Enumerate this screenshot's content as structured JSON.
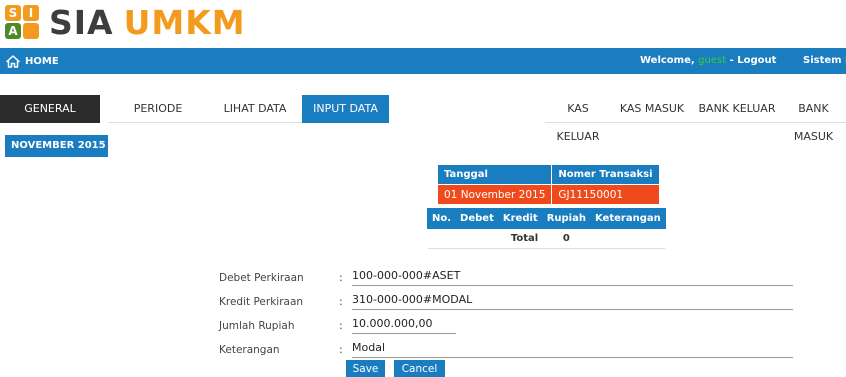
{
  "logo": {
    "sia": "SIA",
    "umkm": "UMKM",
    "tiles": [
      "S",
      "I",
      "A",
      ""
    ]
  },
  "topbar": {
    "home_label": "HOME",
    "welcome_prefix": "Welcome, ",
    "user": "guest",
    "logout": " - Logout",
    "sistem": "Sistem In"
  },
  "tabs": {
    "left": [
      "GENERAL JOURNAL",
      "PERIODE",
      "LIHAT DATA",
      "INPUT DATA"
    ],
    "right": [
      "KAS KELUAR",
      "KAS MASUK",
      "BANK KELUAR",
      "BANK MASUK"
    ]
  },
  "period_badge": "NOVEMBER 2015",
  "header_table": {
    "columns": [
      "Tanggal",
      "Nomer Transaksi"
    ],
    "row": [
      "01 November 2015",
      "GJ11150001"
    ]
  },
  "detail_table": {
    "columns": [
      "No.",
      "Debet",
      "Kredit",
      "Rupiah",
      "Keterangan"
    ],
    "total_label": "Total",
    "total_value": "0"
  },
  "form": {
    "debet_label": "Debet Perkiraan",
    "debet_value": "100-000-000#ASET",
    "kredit_label": "Kredit Perkiraan",
    "kredit_value": "310-000-000#MODAL",
    "jumlah_label": "Jumlah Rupiah",
    "jumlah_value": "10.000.000,00",
    "keterangan_label": "Keterangan",
    "keterangan_value": "Modal",
    "colon": ":"
  },
  "buttons": {
    "save": "Save",
    "cancel": "Cancel"
  },
  "colors": {
    "primary": "#1a7dc0",
    "accent_orange": "#f29b1f",
    "highlight": "#f04a1c",
    "user_green": "#34d134"
  }
}
